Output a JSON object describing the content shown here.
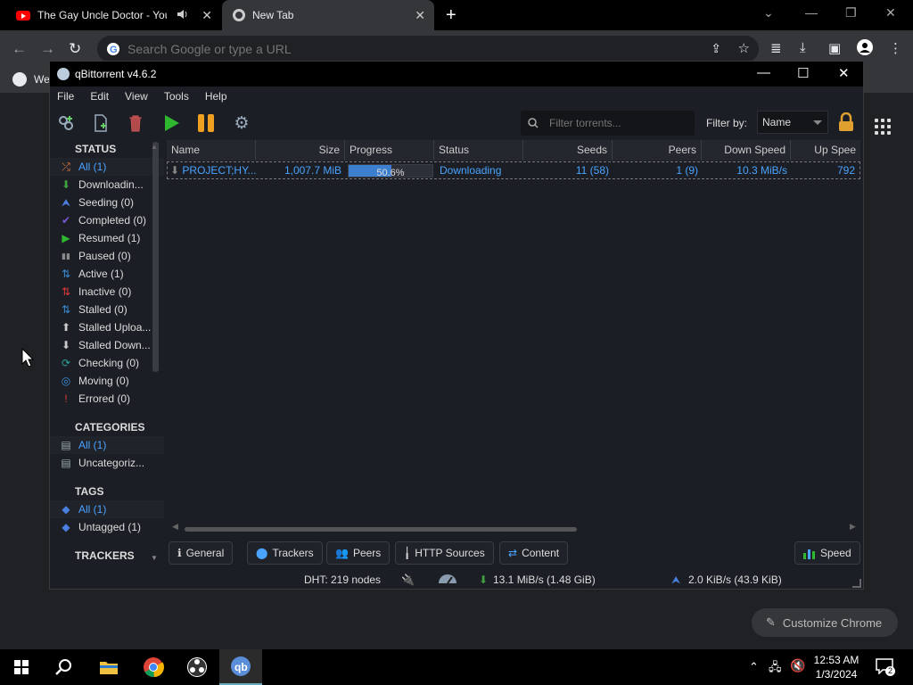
{
  "chrome": {
    "tabs": [
      {
        "title": "The Gay Uncle Doctor - YouTube",
        "icon": "youtube-icon"
      },
      {
        "title": "New Tab",
        "icon": "chrome-icon"
      }
    ],
    "omnibox_placeholder": "Search Google or type a URL",
    "bookmark_label": "We",
    "customize_label": "Customize Chrome"
  },
  "qbt": {
    "title": "qBittorrent v4.6.2",
    "menu": [
      "File",
      "Edit",
      "View",
      "Tools",
      "Help"
    ],
    "filter_placeholder": "Filter torrents...",
    "filter_by_label": "Filter by:",
    "filter_by_value": "Name",
    "sidebar": {
      "status_title": "STATUS",
      "status_items": [
        {
          "label": "All (1)",
          "icon": "shuffle-icon",
          "color": "#e8793a"
        },
        {
          "label": "Downloadin...",
          "icon": "arrow-down-icon",
          "color": "#3fa03f"
        },
        {
          "label": "Seeding (0)",
          "icon": "double-chevron-up-icon",
          "color": "#4a7fe0"
        },
        {
          "label": "Completed (0)",
          "icon": "checkmark-icon",
          "color": "#7b57d6"
        },
        {
          "label": "Resumed (1)",
          "icon": "play-icon",
          "color": "#2fb82f"
        },
        {
          "label": "Paused (0)",
          "icon": "pause-icon",
          "color": "#8a8a8a"
        },
        {
          "label": "Active (1)",
          "icon": "up-down-arrows-icon",
          "color": "#3a8fd8"
        },
        {
          "label": "Inactive (0)",
          "icon": "up-down-arrows-icon",
          "color": "#e03a3a"
        },
        {
          "label": "Stalled (0)",
          "icon": "up-down-arrows-icon",
          "color": "#3a8fd8"
        },
        {
          "label": "Stalled Uploa...",
          "icon": "arrow-up-icon",
          "color": "#cccccc"
        },
        {
          "label": "Stalled Down...",
          "icon": "arrow-down-icon",
          "color": "#cccccc"
        },
        {
          "label": "Checking (0)",
          "icon": "refresh-icon",
          "color": "#2aa198"
        },
        {
          "label": "Moving (0)",
          "icon": "target-icon",
          "color": "#3a8fd8"
        },
        {
          "label": "Errored (0)",
          "icon": "exclamation-icon",
          "color": "#e03a3a"
        }
      ],
      "categories_title": "CATEGORIES",
      "category_items": [
        {
          "label": "All (1)",
          "icon": "list-icon",
          "color": "#9aa"
        },
        {
          "label": "Uncategoriz...",
          "icon": "list-icon",
          "color": "#9aa"
        }
      ],
      "tags_title": "TAGS",
      "tag_items": [
        {
          "label": "All (1)",
          "icon": "tag-icon",
          "color": "#4a7fe0"
        },
        {
          "label": "Untagged (1)",
          "icon": "tag-icon",
          "color": "#4a7fe0"
        }
      ],
      "trackers_title": "TRACKERS"
    },
    "columns": [
      "Name",
      "Size",
      "Progress",
      "Status",
      "Seeds",
      "Peers",
      "Down Speed",
      "Up Spee"
    ],
    "torrent": {
      "name": "PROJECT;HY...",
      "size": "1,007.7 MiB",
      "progress": 0.506,
      "progress_label": "50.6%",
      "status": "Downloading",
      "seeds": "11 (58)",
      "peers": "1 (9)",
      "down_speed": "10.3 MiB/s",
      "up_speed": "792"
    },
    "prop_tabs": [
      "General",
      "Trackers",
      "Peers",
      "HTTP Sources",
      "Content"
    ],
    "speed_label": "Speed",
    "status": {
      "dht": "DHT: 219 nodes",
      "download": "13.1 MiB/s (1.48 GiB)",
      "upload": "2.0 KiB/s (43.9 KiB)"
    }
  },
  "taskbar": {
    "time": "12:53 AM",
    "date": "1/3/2024",
    "notifications": "2"
  }
}
